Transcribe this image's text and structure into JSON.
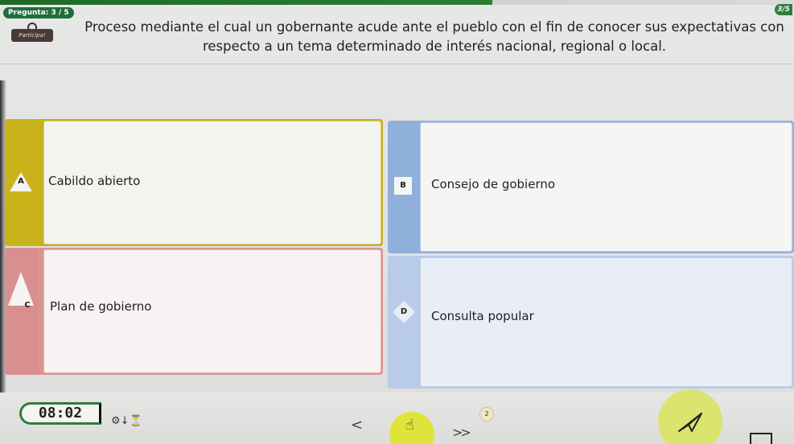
{
  "header": {
    "question_counter": "Pregunta: 3 / 5",
    "progress_badge": "3/5",
    "logo_label": "Participa!"
  },
  "question": {
    "text": "Proceso mediante el cual un gobernante acude ante el pueblo con el fin de conocer sus expectativas con respecto a un tema determinado de interés nacional, regional o local."
  },
  "answers": [
    {
      "letter": "A",
      "label": "Cabildo abierto",
      "color": "#c9b31a"
    },
    {
      "letter": "B",
      "label": "Consejo de gobierno",
      "color": "#8fb0db"
    },
    {
      "letter": "C",
      "label": "Plan de gobierno",
      "color": "#d98f8f"
    },
    {
      "letter": "D",
      "label": "Consulta popular",
      "color": "#b8cbe8"
    }
  ],
  "footer": {
    "timer": "08:02",
    "timer_settings_icon": "timer-settings-icon",
    "prev_label": "<",
    "next_label": ">>",
    "skip_count": "2"
  }
}
